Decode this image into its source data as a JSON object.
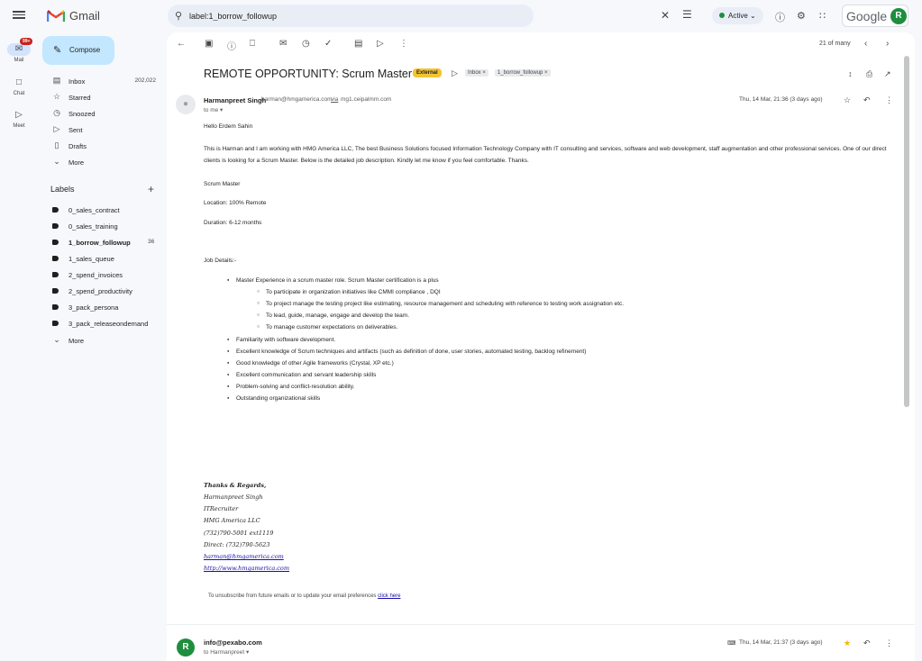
{
  "topbar": {
    "app_name": "Gmail",
    "search_value": "label:1_borrow_followup",
    "status": "Active",
    "brand": "Google",
    "avatar_letter": "R"
  },
  "rail": {
    "badge": "99+",
    "items": [
      {
        "label": "Mail",
        "icon": "mail-icon"
      },
      {
        "label": "Chat",
        "icon": "chat-icon"
      },
      {
        "label": "Meet",
        "icon": "meet-icon"
      }
    ]
  },
  "sidebar": {
    "compose": "Compose",
    "nav": [
      {
        "label": "Inbox",
        "count": "202,022",
        "icon": "inbox-icon"
      },
      {
        "label": "Starred",
        "count": "",
        "icon": "star-icon"
      },
      {
        "label": "Snoozed",
        "count": "",
        "icon": "clock-icon"
      },
      {
        "label": "Sent",
        "count": "",
        "icon": "send-icon"
      },
      {
        "label": "Drafts",
        "count": "",
        "icon": "draft-icon"
      },
      {
        "label": "More",
        "count": "",
        "icon": "chevron-down-icon"
      }
    ],
    "labels_header": "Labels",
    "labels": [
      {
        "label": "0_sales_contract",
        "count": ""
      },
      {
        "label": "0_sales_training",
        "count": ""
      },
      {
        "label": "1_borrow_followup",
        "count": "36"
      },
      {
        "label": "1_sales_queue",
        "count": ""
      },
      {
        "label": "2_spend_invoices",
        "count": ""
      },
      {
        "label": "2_spend_productivity",
        "count": ""
      },
      {
        "label": "3_pack_persona",
        "count": ""
      },
      {
        "label": "3_pack_releaseondemand",
        "count": ""
      }
    ],
    "labels_more": "More"
  },
  "toolbar": {
    "page_count": "21 of many"
  },
  "email": {
    "subject": "REMOTE OPPORTUNITY: Scrum Master",
    "external_tag": "External",
    "chips": [
      "Inbox ×",
      "1_borrow_followup ×"
    ],
    "from_name": "Harmanpreet Singh",
    "from_email": "harman@hmgamerica.com",
    "via": "via",
    "via_domain": "mg1.ceipalmm.com",
    "to": "to me ▾",
    "date": "Thu, 14 Mar, 21:36 (3 days ago)",
    "greeting": "Hello Erdem Sahin",
    "intro": "This is Harman and I am working with HMG America LLC, The best Business Solutions focused Information Technology Company with IT consulting and services, software and web development, staff augmentation and other professional services. One of our direct clients is looking for a Scrum Master.  Below is the detailed job description. Kindly let me know if you feel comfortable. Thanks.",
    "role": "Scrum Master",
    "location": "Location: 100% Remote",
    "duration": "Duration: 6-12 months",
    "details_header": "Job Details:-",
    "bullets": [
      "Master Experience in a scrum master role. Scrum Master certification is a plus",
      "Familiarity with software development.",
      "Excellent knowledge of Scrum techniques and artifacts (such as definition of done, user stories, automated testing, backlog refinement)",
      "Good knowledge of other Agile frameworks (Crystal, XP etc.)",
      "Excellent communication and servant leadership skills",
      "Problem-solving and conflict-resolution ability.",
      "Outstanding organizational skills"
    ],
    "sub_bullets": [
      "To participate in organization initiatives like CMMI compliance , DQI",
      "To project manage the testing project like estimating, resource management and scheduling with reference to testing work assignation etc.",
      "To lead, guide, manage, engage and develop the team.",
      "To manage customer expectations on deliverables."
    ],
    "signature": {
      "regards": "Thanks & Regards,",
      "name": "Harmanpreet Singh",
      "title": "ITRecruiter",
      "company": "HMG America LLC",
      "phone": "(732)790-5001 ext1119",
      "direct": "Direct: (732)790-5623",
      "email": "harman@hmgamerica.com",
      "web": "http://www.hmgamerica.com"
    },
    "unsubscribe_text": "To unsubscribe from future emails or to update your email preferences",
    "unsubscribe_link": "click here"
  },
  "reply": {
    "avatar_letter": "R",
    "from": "info@pexabo.com",
    "to": "to Harmanpreet ▾",
    "date": "Thu, 14 Mar, 21:37 (3 days ago)"
  },
  "colors": {
    "accent": "#c2e7ff",
    "brand_red": "#ea4335",
    "active_green": "#1e8e3e",
    "external_tag": "#f4c430"
  }
}
